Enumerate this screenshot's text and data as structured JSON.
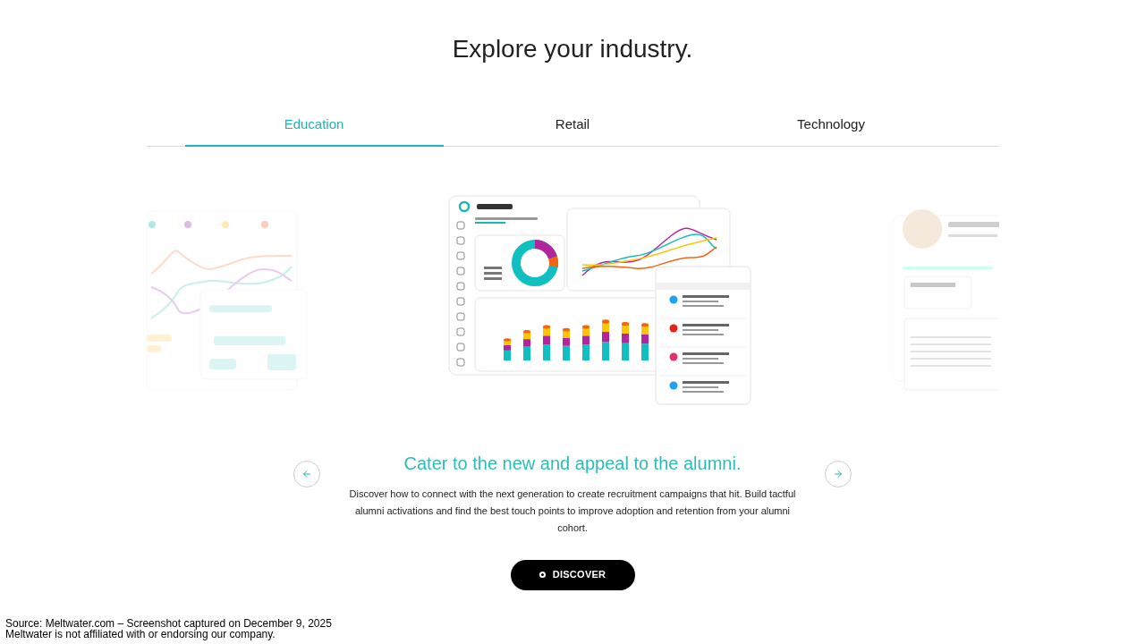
{
  "title": "Explore your industry.",
  "tabs": [
    {
      "label": "Education",
      "selected": true
    },
    {
      "label": "Retail",
      "selected": false
    },
    {
      "label": "Technology",
      "selected": false
    }
  ],
  "slide": {
    "heading": "Cater to the new and appeal to the alumni.",
    "body": "Discover how to connect with the next generation to create recruitment campaigns that hit. Build tactful alumni activations and find the best touch points to improve adoption and retention from your alumni cohort."
  },
  "button": {
    "label": "DISCOVER"
  },
  "footer": [
    "Source: Meltwater.com – Screenshot captured on December 9, 2025",
    "Meltwater is not affiliated with or endorsing our company."
  ]
}
